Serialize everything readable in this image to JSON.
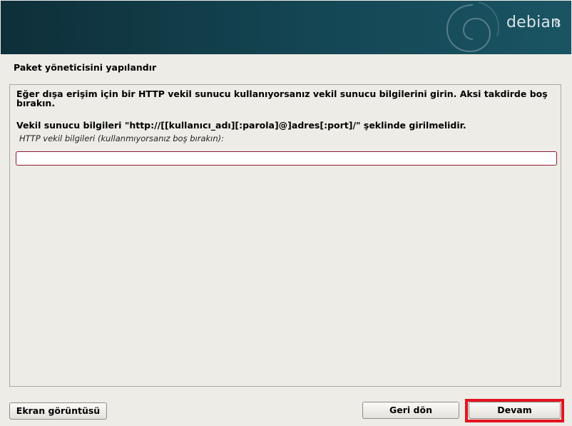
{
  "banner": {
    "brand": "debian",
    "version": "8",
    "logo_icon": "debian-swirl-icon"
  },
  "step": {
    "title": "Paket yöneticisini yapılandır"
  },
  "content": {
    "description": "Eğer dışa erişim için bir HTTP vekil sunucu kullanıyorsanız vekil sunucu bilgilerini girin. Aksi takdirde boş bırakın.",
    "format_note": "Vekil sunucu bilgileri \"http://[[kullanıcı_adı][:parola]@]adres[:port]/\" şeklinde girilmelidir.",
    "field_label": "HTTP vekil bilgileri (kullanmıyorsanız boş bırakın):",
    "field_value": ""
  },
  "buttons": {
    "screenshot": "Ekran görüntüsü",
    "back": "Geri dön",
    "continue": "Devam"
  },
  "colors": {
    "banner": "#144654",
    "input_border": "#8c1c2d",
    "highlight": "#e3141f"
  }
}
